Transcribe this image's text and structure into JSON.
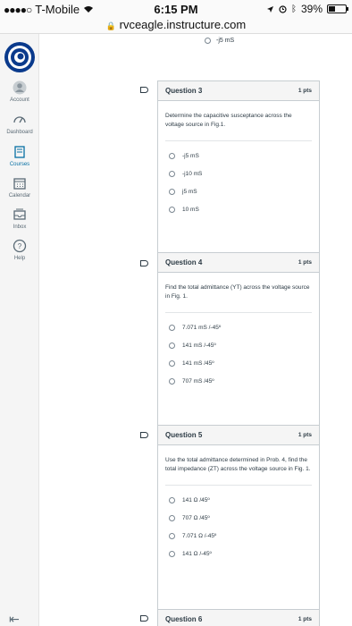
{
  "status_bar": {
    "carrier": "T-Mobile",
    "time": "6:15 PM",
    "battery": "39%",
    "url": "rvceagle.instructure.com"
  },
  "nav": {
    "items": [
      {
        "label": "Account"
      },
      {
        "label": "Dashboard"
      },
      {
        "label": "Courses"
      },
      {
        "label": "Calendar"
      },
      {
        "label": "Inbox"
      },
      {
        "label": "Help"
      }
    ]
  },
  "previous_answer": "-j5 mS",
  "questions": [
    {
      "title": "Question 3",
      "points": "1 pts",
      "text": "Determine the capacitive susceptance across the voltage source in Fig.1.",
      "answers": [
        "-j5 mS",
        "-j10 mS",
        "j5 mS",
        "10 mS"
      ]
    },
    {
      "title": "Question 4",
      "points": "1 pts",
      "text": "Find the total admittance (YT) across the voltage source in Fig. 1.",
      "answers": [
        "7.071 mS /-45º",
        "141 mS /-45º",
        "141 mS /45º",
        "707 mS /45º"
      ]
    },
    {
      "title": "Question 5",
      "points": "1 pts",
      "text": "Use the total admittance determined in Prob. 4, find the total impedance (ZT) across the voltage source in Fig. 1.",
      "answers": [
        "141 Ω /45º",
        "707 Ω /45º",
        "7.071 Ω /-45º",
        "141 Ω /-45º"
      ]
    },
    {
      "title": "Question 6",
      "points": "1 pts"
    }
  ]
}
